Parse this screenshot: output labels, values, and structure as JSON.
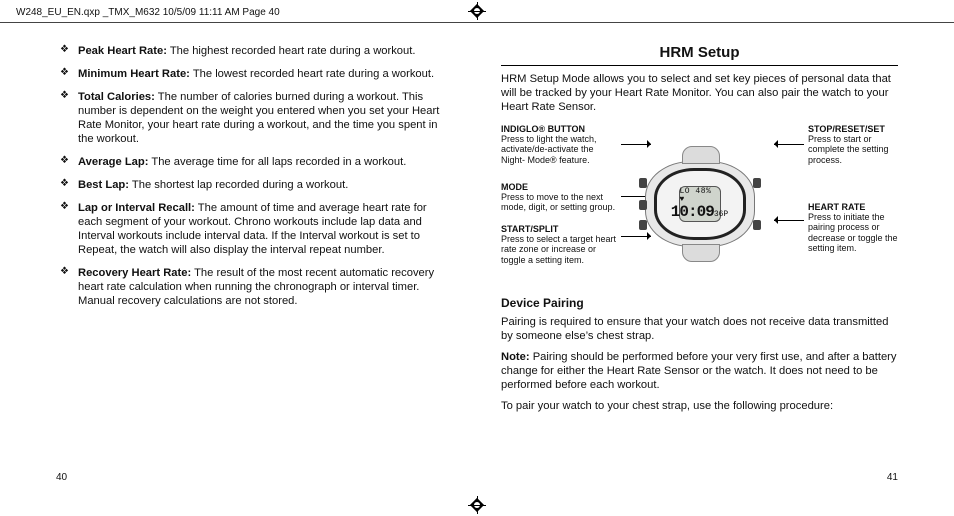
{
  "header": {
    "file_tag": "W248_EU_EN.qxp _TMX_M632  10/5/09  11:11 AM  Page 40"
  },
  "page_numbers": {
    "left": "40",
    "right": "41"
  },
  "left_column": {
    "definitions": [
      {
        "term": "Peak Heart Rate:",
        "desc": "The highest recorded heart rate during a workout."
      },
      {
        "term": "Minimum Heart Rate:",
        "desc": "The lowest recorded heart rate during a workout."
      },
      {
        "term": "Total Calories:",
        "desc": "The number of calories burned during a workout. This number is dependent on the weight you entered when you set your Heart Rate Monitor, your heart rate during a workout, and the time you spent in the workout."
      },
      {
        "term": "Average Lap:",
        "desc": "The average time for all laps recorded in a workout."
      },
      {
        "term": "Best Lap:",
        "desc": "The shortest lap recorded during a workout."
      },
      {
        "term": "Lap or Interval Recall:",
        "desc": "The amount of time and average heart rate for each segment of your workout. Chrono workouts include lap data and Interval workouts include interval data. If the Interval workout is set to Repeat, the watch will also display the interval repeat number."
      },
      {
        "term": "Recovery Heart Rate:",
        "desc": "The result of the most recent automatic recovery heart rate calculation when running the chronograph or interval timer. Manual recovery calculations are not stored."
      }
    ]
  },
  "right_column": {
    "title": "HRM Setup",
    "intro": "HRM Setup Mode allows you to select and set key pieces of personal data that will be tracked by your Heart Rate Monitor. You can also pair the watch to your Heart Rate Sensor.",
    "callouts": {
      "indiglo": {
        "cap": "INDIGLO® BUTTON",
        "body": "Press to light the watch, activate/de-activate the Night- Mode® feature."
      },
      "mode": {
        "cap": "MODE",
        "body": "Press to move to the next mode, digit, or setting group."
      },
      "start": {
        "cap": "START/SPLIT",
        "body": "Press to select a target heart rate zone or increase or toggle a setting item."
      },
      "stop": {
        "cap": "STOP/RESET/SET",
        "body": "Press to start or complete the setting process."
      },
      "heartrate": {
        "cap": "HEART RATE",
        "body": "Press to initiate the pairing process or decrease or toggle the setting item."
      }
    },
    "watch": {
      "line1": "LO  48% ♥",
      "line2": "10:09",
      "line2_suffix": "36P"
    },
    "device_pairing": {
      "heading": "Device Pairing",
      "p1": "Pairing is required to ensure that your watch does not receive data transmitted by someone else’s chest strap.",
      "note_label": "Note:",
      "note_body": "Pairing should be performed before your very first use, and after a battery change for either the Heart Rate Sensor or the watch. It does not need to be performed before each workout.",
      "p3": "To pair your watch to your chest strap, use the following procedure:"
    }
  }
}
